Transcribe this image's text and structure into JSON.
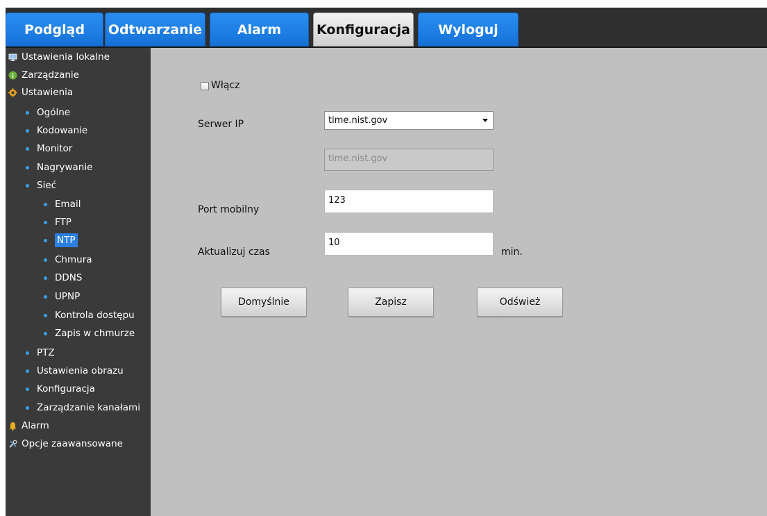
{
  "nav": {
    "tabs": [
      {
        "label": "Podgląd",
        "active": false
      },
      {
        "label": "Odtwarzanie",
        "active": false
      },
      {
        "label": "Alarm",
        "active": false
      },
      {
        "label": "Konfiguracja",
        "active": true
      },
      {
        "label": "Wyloguj",
        "active": false
      }
    ]
  },
  "sidebar": {
    "items": [
      {
        "label": "Ustawienia lokalne",
        "icon": "monitor-icon"
      },
      {
        "label": "Zarządzanie",
        "icon": "info-icon"
      },
      {
        "label": "Ustawienia",
        "icon": "gear-icon"
      },
      {
        "label": "Ogólne"
      },
      {
        "label": "Kodowanie"
      },
      {
        "label": "Monitor"
      },
      {
        "label": "Nagrywanie"
      },
      {
        "label": "Sieć"
      },
      {
        "label": "Email"
      },
      {
        "label": "FTP"
      },
      {
        "label": "NTP",
        "selected": true
      },
      {
        "label": "Chmura"
      },
      {
        "label": "DDNS"
      },
      {
        "label": "UPNP"
      },
      {
        "label": "Kontrola dostępu"
      },
      {
        "label": "Zapis w chmurze"
      },
      {
        "label": "PTZ"
      },
      {
        "label": "Ustawienia obrazu"
      },
      {
        "label": "Konfiguracja"
      },
      {
        "label": "Zarządzanie kanałami"
      },
      {
        "label": "Alarm",
        "icon": "bell-icon"
      },
      {
        "label": "Opcje zaawansowane",
        "icon": "tools-icon"
      }
    ]
  },
  "form": {
    "enable_label": "Włącz",
    "enable_checked": false,
    "server_label": "Serwer IP",
    "server_selected": "time.nist.gov",
    "server_custom": "time.nist.gov",
    "port_label": "Port mobilny",
    "port_value": "123",
    "update_label": "Aktualizuj czas",
    "update_value": "10",
    "update_unit": "min."
  },
  "buttons": {
    "default_label": "Domyślnie",
    "save_label": "Zapisz",
    "refresh_label": "Odśwież"
  },
  "colors": {
    "tab_blue": "#1f7fe6",
    "sidebar_bg": "#3a3a3a",
    "panel_bg": "#c0c0c0",
    "selection": "#2b7fe0"
  }
}
